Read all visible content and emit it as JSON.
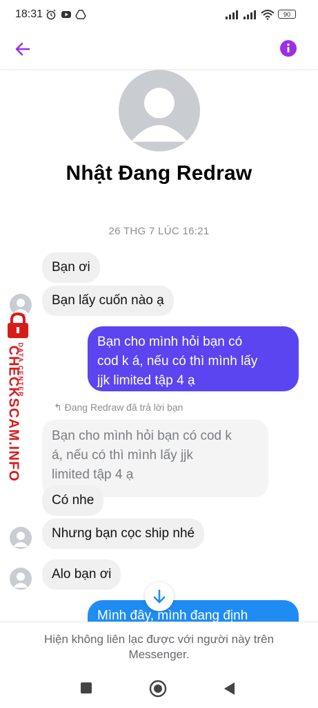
{
  "status_bar": {
    "time": "18:31",
    "battery": "90"
  },
  "header": {
    "back_icon": "arrow-left-icon",
    "info_icon": "info-icon",
    "accent": "#9b2fe6"
  },
  "profile": {
    "name": "Nhật Đang Redraw"
  },
  "timestamp": "26 THG 7 LÚC 16:21",
  "messages": {
    "m1": "Bạn ơi",
    "m2": "Bạn lấy cuốn nào ạ",
    "m3_lines": [
      "Bạn cho mình hỏi bạn có",
      "cod k á, nếu có thì mình lấy",
      "jjk limited tập 4 ạ"
    ],
    "reply_note": "Đang Redraw đã trả lời bạn",
    "quoted_lines": [
      "Bạn cho mình hỏi bạn có cod k",
      "á, nếu có thì mình lấy jjk",
      "limited tập 4 ạ"
    ],
    "m4": "Có nhe",
    "m5": "Nhưng bạn cọc ship nhé",
    "m6": "Alo bạn ơi",
    "m7_partial": "Mình đây, mình đang định"
  },
  "watermark": {
    "main": "CHECKSCAM.INFO",
    "sub": "DATA CENTER"
  },
  "footer": {
    "lines": [
      "Hiện không liên lạc được với người này trên",
      "Messenger."
    ]
  },
  "colors": {
    "outgoing_purple": "#5b45f0",
    "outgoing_blue": "#1f8cf3",
    "incoming": "#f0f0f0"
  }
}
